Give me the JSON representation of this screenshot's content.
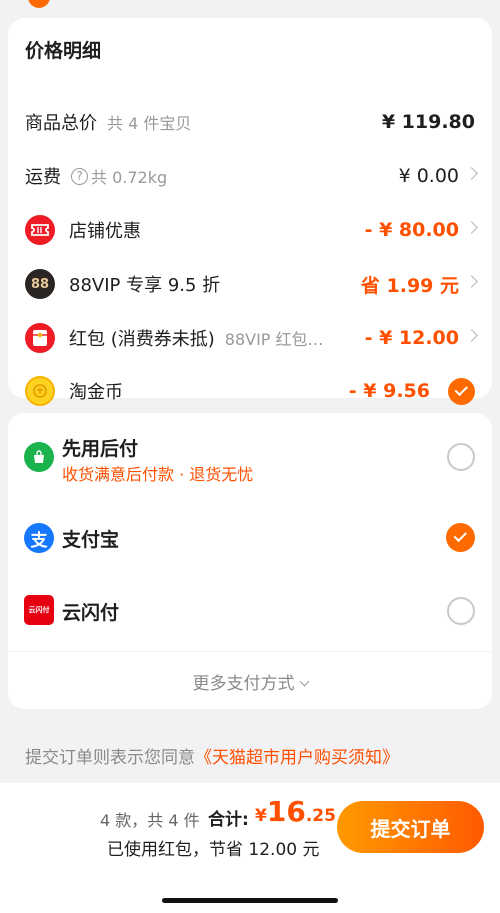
{
  "price_card": {
    "title": "价格明细",
    "goods": {
      "label": "商品总价",
      "sub": "共 4 件宝贝",
      "value": "¥ 119.80"
    },
    "shipping": {
      "label": "运费",
      "help_icon": "?",
      "sub": "共 0.72kg",
      "value": "¥ 0.00"
    },
    "shop_discount": {
      "label": "店铺优惠",
      "value": "- ¥ 80.00",
      "icon": "coupon-icon"
    },
    "vip": {
      "label": "88VIP 专享 9.5 折",
      "badge": "88",
      "value": "省 1.99 元",
      "icon": "88vip-icon"
    },
    "red_packet": {
      "label": "红包 (消费券未抵)",
      "sub": "88VIP 红包…",
      "value": "- ¥ 12.00",
      "icon": "red-packet-icon"
    },
    "taojinbi": {
      "label": "淘金币",
      "value": "- ¥ 9.56",
      "checked": true,
      "icon": "gold-coin-icon"
    }
  },
  "payment": {
    "options": [
      {
        "label": "先用后付",
        "sub": "收货满意后付款 · 退货无忧",
        "selected": false,
        "icon": "pay-later-icon"
      },
      {
        "label": "支付宝",
        "selected": true,
        "icon": "alipay-icon",
        "glyph": "支"
      },
      {
        "label": "云闪付",
        "selected": false,
        "icon": "unionpay-icon",
        "badge": "云闪付"
      }
    ],
    "more": "更多支付方式"
  },
  "agreement": {
    "prefix": "提交订单则表示您同意",
    "link": "《天猫超市用户购买须知》"
  },
  "footer": {
    "count": "4 款，共 4 件",
    "total_label": "合计:",
    "currency": "¥",
    "total_int": "16",
    "total_dec": ".25",
    "saving": "已使用红包，节省 12.00 元",
    "submit": "提交订单"
  },
  "colors": {
    "accent": "#ff5000",
    "check": "#ff6a00",
    "alipay": "#1677ff",
    "pay_later": "#1bb34b",
    "red": "#ee1c25"
  }
}
